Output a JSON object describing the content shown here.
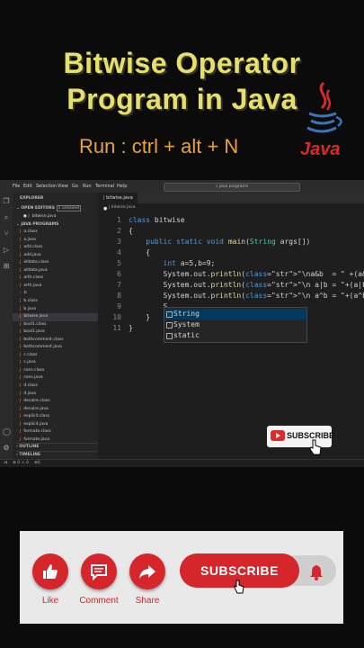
{
  "overlay": {
    "title_line1": "Bitwise Operator",
    "title_line2": "Program in Java",
    "run_hint": "Run : ctrl + alt + N",
    "logo_text": "Java"
  },
  "vscode": {
    "menu": [
      "File",
      "Edit",
      "Selection",
      "View",
      "Go",
      "Run",
      "Terminal",
      "Help"
    ],
    "search_placeholder": "java programs",
    "explorer_label": "EXPLORER",
    "open_editors_label": "OPEN EDITORS",
    "unsaved_badge": "1 unsaved",
    "open_file": "bitwise.java",
    "folder_label": "JAVA PROGRAMS",
    "files": [
      "a.class",
      "a.java",
      "add.class",
      "add.java",
      "alldata.class",
      "alldata.java",
      "arth.class",
      "arth.java",
      "b",
      "b.class",
      "b.java",
      "bitwise.java",
      "bool1.class",
      "bool1.java",
      "bothcomment.class",
      "bothcomment.java",
      "c.class",
      "c.java",
      "cons.class",
      "cons.java",
      "d.class",
      "d.java",
      "decalre.class",
      "decalre.java",
      "explicit.class",
      "explicit.java",
      "formate.class",
      "formate.java"
    ],
    "outline_label": "OUTLINE",
    "timeline_label": "TIMELINE",
    "tab_label": "bitwise.java",
    "breadcrumb": "bitwise.java",
    "code_lines": [
      {
        "n": "1",
        "t": "class bitwise"
      },
      {
        "n": "2",
        "t": "{"
      },
      {
        "n": "3",
        "t": "    public static void main(String args[])"
      },
      {
        "n": "4",
        "t": "    {"
      },
      {
        "n": "5",
        "t": "        int a=5,b=9;"
      },
      {
        "n": "6",
        "t": "        System.out.println(\"\\na&b  = \" +(a&b));"
      },
      {
        "n": "7",
        "t": "        System.out.println(\"\\n a|b = \"+(a|b));"
      },
      {
        "n": "8",
        "t": "        System.out.println(\"\\n a^b = \"+(a^b));"
      },
      {
        "n": "9",
        "t": "        S"
      },
      {
        "n": "10",
        "t": "    }"
      },
      {
        "n": "11",
        "t": "}"
      }
    ],
    "suggestions": [
      "String",
      "System",
      "static"
    ],
    "status_items": [
      "⊗ 0  ⚠ 0",
      "⊕0"
    ]
  },
  "subscribe_tag": "SUBSCRIBE",
  "actions": {
    "like": "Like",
    "comment": "Comment",
    "share": "Share",
    "subscribe": "SUBSCRIBE"
  },
  "colors": {
    "title": "#e6e06a",
    "hint": "#e8a23a",
    "accent_red": "#d5262c"
  }
}
